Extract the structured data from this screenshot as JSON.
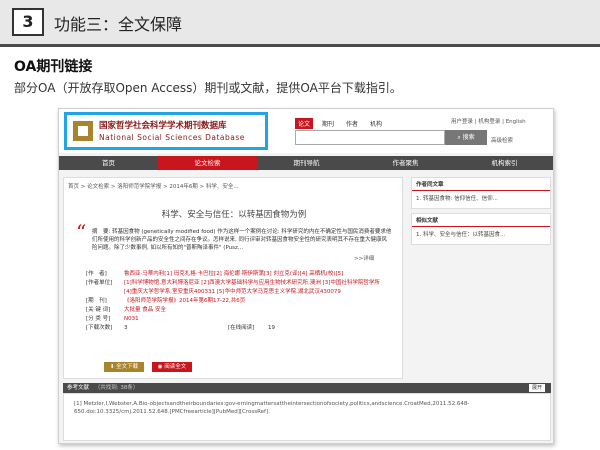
{
  "slide": {
    "number": "3",
    "title": "功能三：全文保障",
    "section_title": "OA期刊链接",
    "section_desc": "部分OA（开放存取Open Access）期刊或文献，提供OA平台下载指引。"
  },
  "site": {
    "logo_cn": "国家哲学社会科学学术期刊数据库",
    "logo_en": "National Social Sciences Database",
    "search_tabs": [
      "论文",
      "期刊",
      "作者",
      "机构"
    ],
    "search_button": "搜索",
    "advanced_search": "高级检索",
    "user_links": "用户登录 | 机构登录 | English",
    "nav": [
      "首页",
      "论文检索",
      "期刊导航",
      "作者聚焦",
      "机构索引"
    ],
    "nav_active": 1,
    "breadcrumb": "首页 > 论文检索 > 洛阳师范学院学报 > 2014年6期 > 科学、安全..."
  },
  "article": {
    "title": "科学、安全与信任：以转基因食物为例",
    "abstract": "摘　要: 转基因食物 (genetically modified food) 作为这样一个案例在讨论: 科学研究的内在不确定性与国民消费者要求他们所使用的科学创新产品的安全性之间存在争议。怎样说来, 同行评审对转基因食物安全性的研究表明其不存在重大健康风险问题。除了少数事例, 如以所有知的\"普斯陶泽事件\" (Pusz...",
    "more": ">>详细",
    "meta": [
      {
        "key": "[作　者]",
        "value": "鲁西亚·马蒂内利[1] 玛克扎格·卡巴拉[2] 海伦娜·斯伊斯蒲[3] 刘立克(译)[4] 高栖机(校)[5]"
      },
      {
        "key": "[作者单位]",
        "value": "[1]科学博物馆,意大利博洛尼亚 [2]西澳大学基础科学与应用生物技术研究所,澳洲 [3]中国社科学院哲学所 [4]重庆大学哲学系,室安重庆400331 [5]华中师范大学马克思主义学院,湖北武汉430079"
      },
      {
        "key": "[期　刊]",
        "value": "《洛阳师范学院学报》2014年第6期17-22,共6页"
      },
      {
        "key": "[关 键 词]",
        "value": "大批量 食品 安全"
      },
      {
        "key": "[分 类 号]",
        "value": "N031"
      }
    ],
    "downloads_label": "[下载次数]",
    "downloads": "3",
    "reads_label": "[在线阅读]",
    "reads": "19",
    "btn_download": "全文下载",
    "btn_read": "阅读全文"
  },
  "sidebar": {
    "box1_title": "作者同文章",
    "box1_item": "1. 转基因食物: 信仰信任、信仰...",
    "box2_title": "相似文献",
    "box2_item": "1. 科学、安全与信任：以转基因食..."
  },
  "references": {
    "title": "参考文献",
    "count": "（共找到: 38条）",
    "toggle": "展开",
    "text": "[1] Metzler,I,Webster,A.Bio-objectsandtheirboundaries:gov-erningmattersattheintersectionofsociety,politics,andscience.CroatMed,2011.52.648-650.doi:10.3325/cmj.2011.52.648.[PMCfreearticle][PubMed][CrossRef]."
  }
}
